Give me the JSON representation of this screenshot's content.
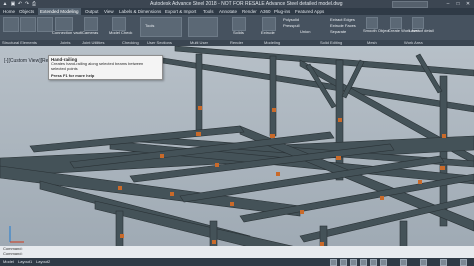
{
  "app": {
    "title": "Autodesk Advance Steel 2018 - NOT FOR RESALE   Advance Steel detailed model.dwg",
    "window_buttons": [
      "–",
      "□",
      "✕"
    ],
    "qat_icons": [
      "logo-icon",
      "save-icon",
      "undo-icon",
      "redo-icon",
      "print-icon"
    ]
  },
  "tabs": [
    {
      "label": "Home",
      "active": false
    },
    {
      "label": "Objects",
      "active": false
    },
    {
      "label": "Extended Modeling",
      "active": true
    },
    {
      "label": "Output",
      "active": false
    },
    {
      "label": "View",
      "active": false
    },
    {
      "label": "Labels & Dimensions",
      "active": false
    },
    {
      "label": "Export & Import",
      "active": false
    },
    {
      "label": "Tools",
      "active": false
    },
    {
      "label": "Annotate",
      "active": false
    },
    {
      "label": "Render",
      "active": false
    },
    {
      "label": "A360",
      "active": false
    },
    {
      "label": "Plug-ins",
      "active": false
    },
    {
      "label": "Featured Apps",
      "active": false
    }
  ],
  "ribbon": {
    "buttons": [
      "Connection vault",
      "Cameras",
      "Model Check",
      "Tools",
      "Solids",
      "Extrude"
    ],
    "list_items": [
      "Polysolid",
      "Presspull",
      "Union",
      "Extract Edges",
      "Extrude Faces",
      "Separate"
    ],
    "right_buttons": [
      "Smooth Object",
      "Create Work Area",
      "Level of detail"
    ],
    "panels": [
      "Structural Elements",
      "Joints",
      "Joint Utilities",
      "Checking",
      "User Sections",
      "Multi User",
      "Render",
      "Modeling",
      "Solid Editing",
      "Mesh",
      "Work Area"
    ]
  },
  "viewport": {
    "label": "[-][Custom View][Realistic]",
    "tooltip": {
      "title": "Hand-railing",
      "description": "Creates hand-railing along selected beams between selected points",
      "help": "Press F1 for more help"
    }
  },
  "command": {
    "line1": "Command:",
    "line2": "Command:"
  },
  "status": {
    "model": "Model",
    "layout1": "Layout1",
    "layout2": "Layout2"
  },
  "colors": {
    "beam": "#445258",
    "beam_edge": "#2a3236",
    "bolt": "#c96a2a",
    "background": "#a9b3bc"
  }
}
